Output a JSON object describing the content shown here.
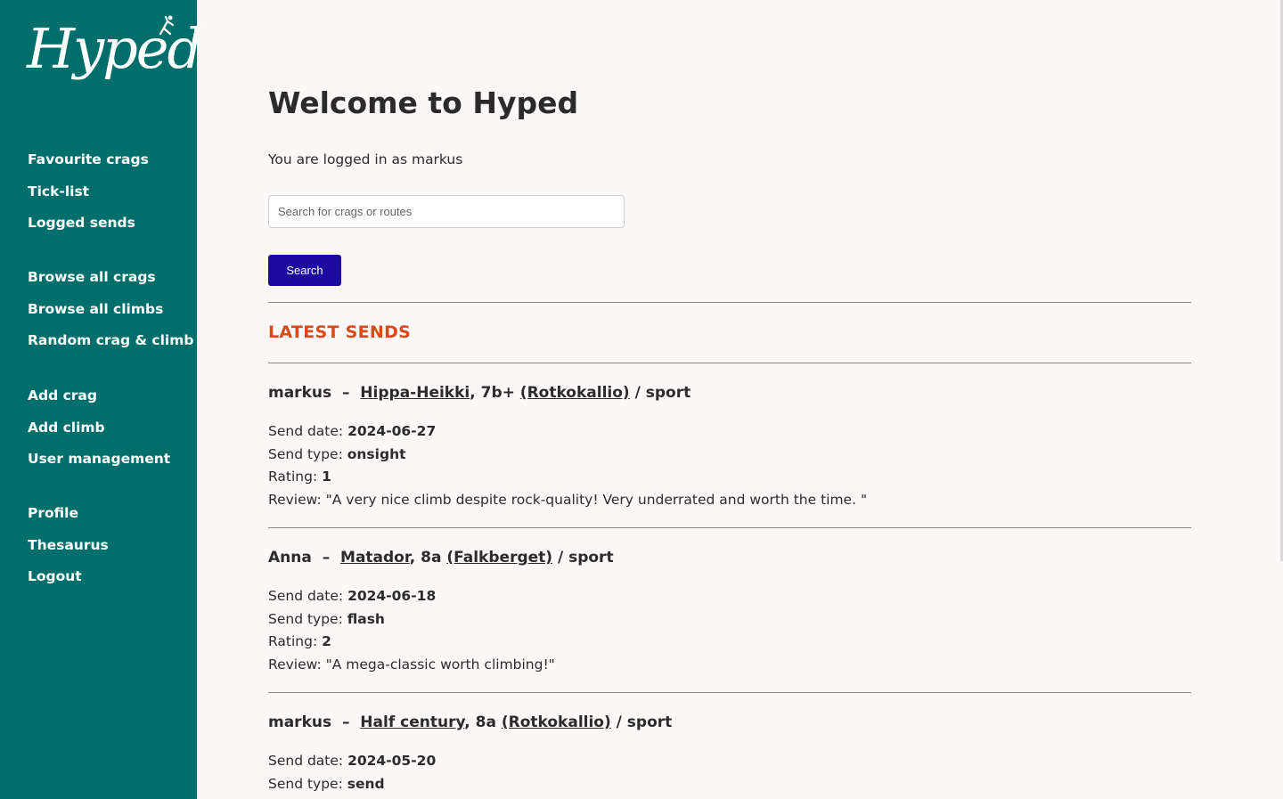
{
  "brand": {
    "logo_text": "Hyped"
  },
  "sidebar": {
    "groups": [
      [
        {
          "label": "Favourite crags"
        },
        {
          "label": "Tick-list"
        },
        {
          "label": "Logged sends"
        }
      ],
      [
        {
          "label": "Browse all crags"
        },
        {
          "label": "Browse all climbs"
        },
        {
          "label": "Random crag & climb"
        }
      ],
      [
        {
          "label": "Add crag"
        },
        {
          "label": "Add climb"
        },
        {
          "label": "User management"
        }
      ],
      [
        {
          "label": "Profile"
        },
        {
          "label": "Thesaurus"
        },
        {
          "label": "Logout"
        }
      ]
    ]
  },
  "main": {
    "title": "Welcome to Hyped",
    "logged_in_text": "You are logged in as markus",
    "search": {
      "placeholder": "Search for crags or routes",
      "value": ""
    },
    "search_button": "Search",
    "latest_sends_title": "LATEST SENDS",
    "labels": {
      "send_date": "Send date: ",
      "send_type": "Send type: ",
      "rating": "Rating: ",
      "review": "Review: "
    },
    "sends": [
      {
        "user": "markus",
        "dash": "–",
        "climb": "Hippa-Heikki",
        "grade": ", 7b+ ",
        "crag": "(Rotkokallio)",
        "style": " / sport",
        "send_date": "2024-06-27",
        "send_type": "onsight",
        "rating": "1",
        "review": "\"A very nice climb despite rock-quality! Very underrated and worth the time. \""
      },
      {
        "user": "Anna",
        "dash": "–",
        "climb": "Matador",
        "grade": ", 8a ",
        "crag": "(Falkberget)",
        "style": " / sport",
        "send_date": "2024-06-18",
        "send_type": "flash",
        "rating": "2",
        "review": "\"A mega-classic worth climbing!\""
      },
      {
        "user": "markus",
        "dash": "–",
        "climb": "Half century",
        "grade": ", 8a ",
        "crag": "(Rotkokallio)",
        "style": " / sport",
        "send_date": "2024-05-20",
        "send_type": "send"
      }
    ]
  },
  "colors": {
    "sidebar_bg": "#006e6a",
    "page_bg": "#fcf8f8",
    "accent": "#d9491a",
    "button_bg": "#1c0a9e"
  }
}
